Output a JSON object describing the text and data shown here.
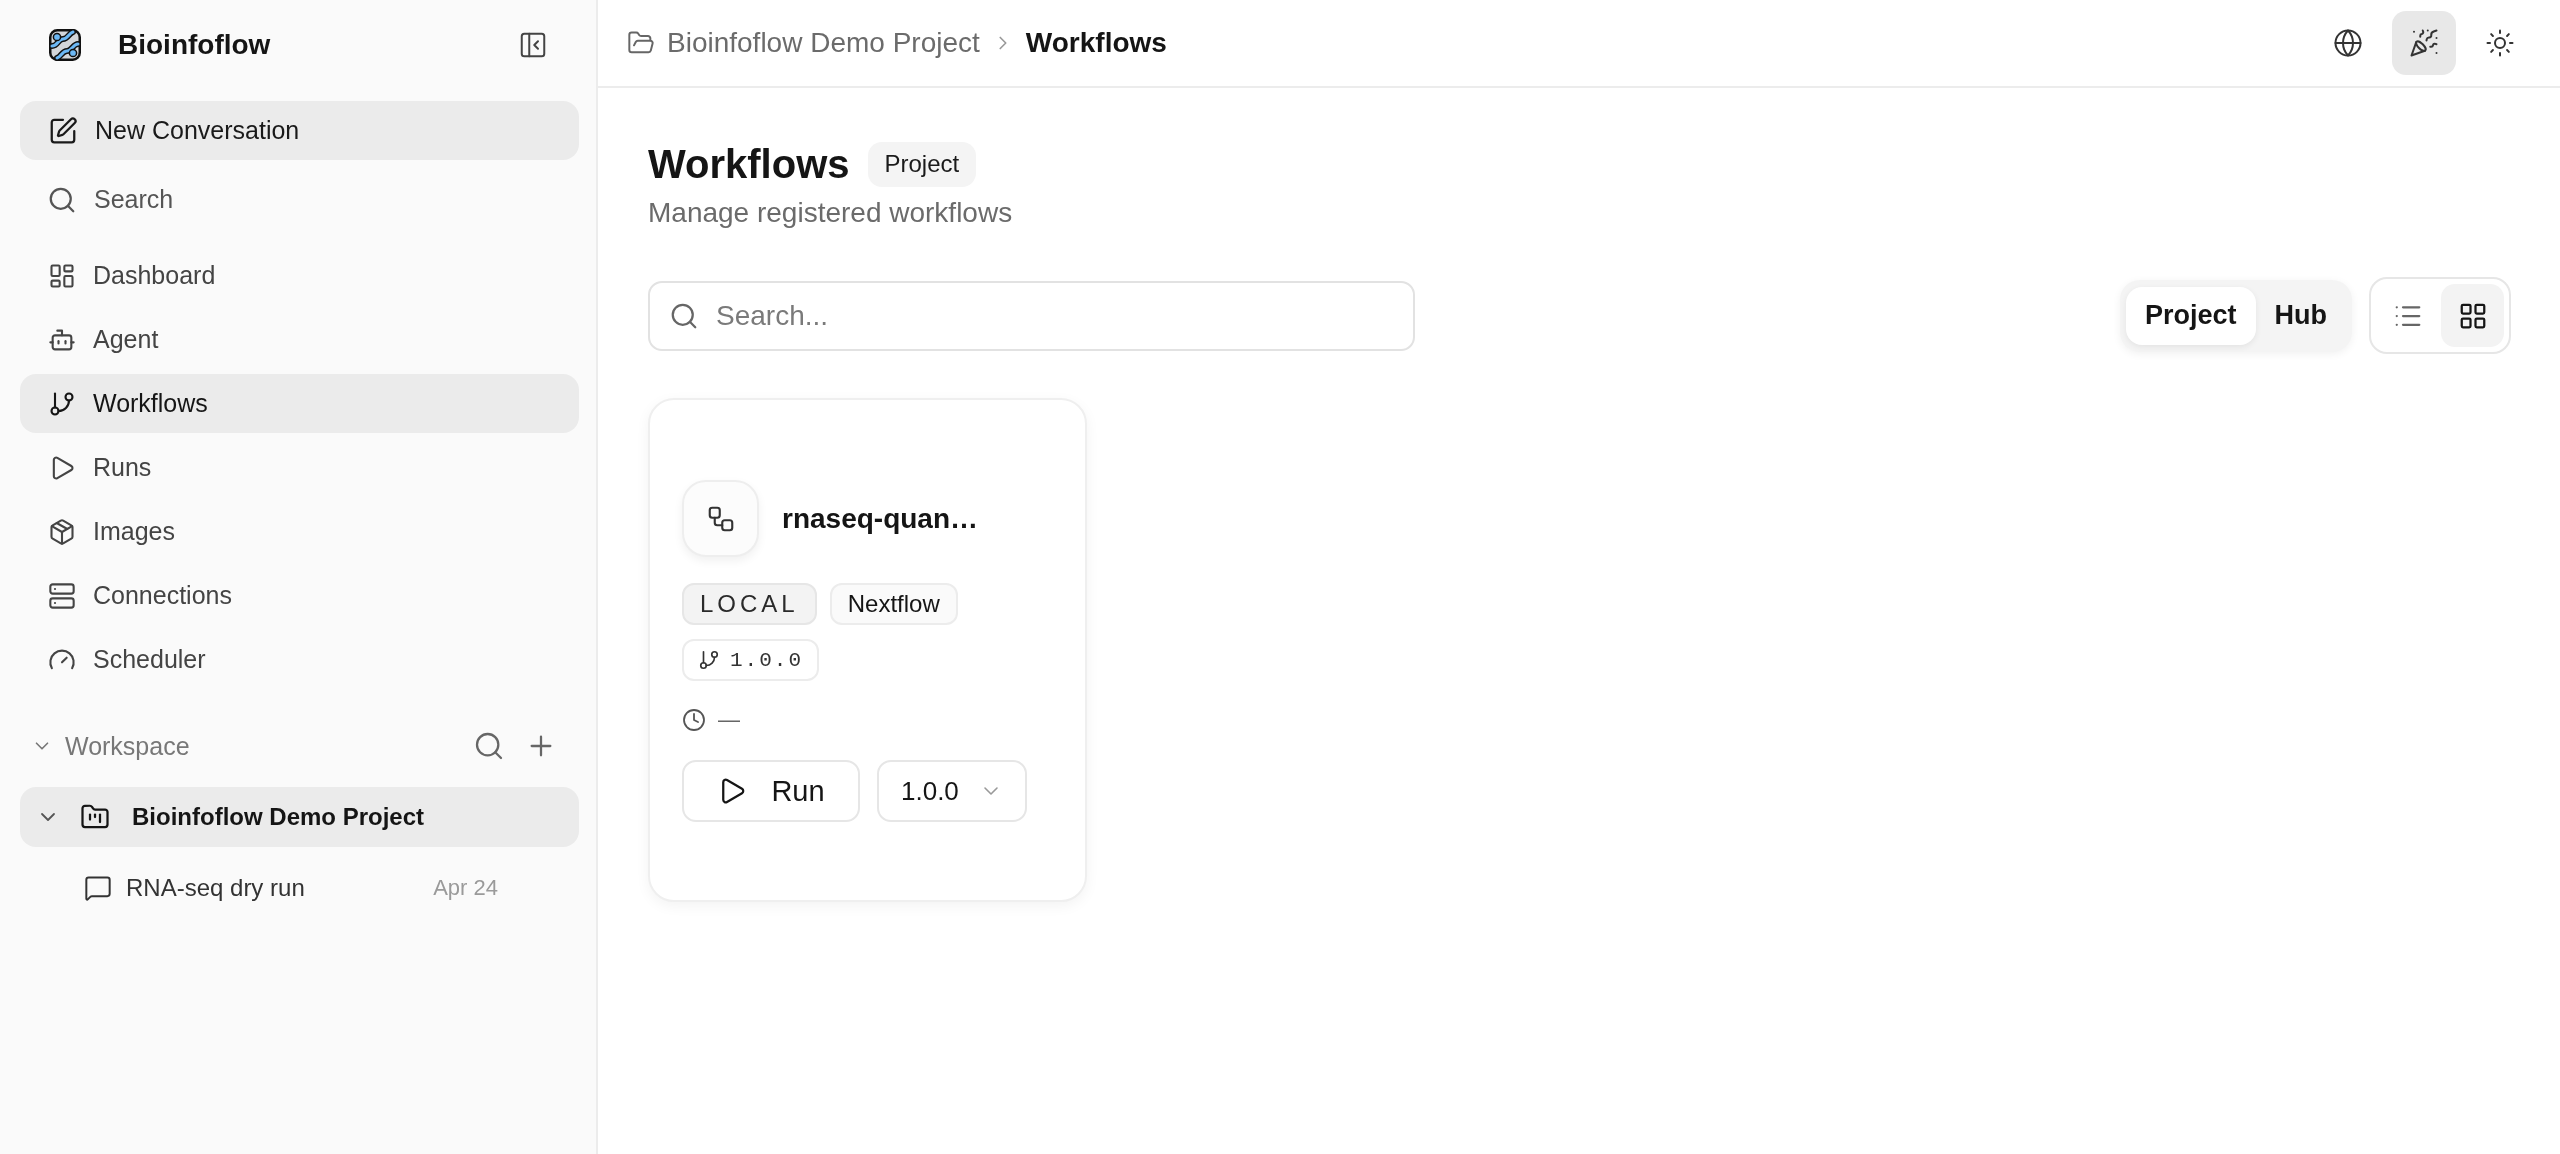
{
  "sidebar": {
    "brand": "Bioinfoflow",
    "new_conversation": "New Conversation",
    "search": "Search",
    "nav_items": [
      {
        "label": "Dashboard",
        "selected": false
      },
      {
        "label": "Agent",
        "selected": false
      },
      {
        "label": "Workflows",
        "selected": true
      },
      {
        "label": "Runs",
        "selected": false
      },
      {
        "label": "Images",
        "selected": false
      },
      {
        "label": "Connections",
        "selected": false
      },
      {
        "label": "Scheduler",
        "selected": false
      }
    ],
    "workspace": {
      "title": "Workspace",
      "expanded": true,
      "projects": [
        {
          "name": "Bioinfoflow Demo Project",
          "expanded": true,
          "selected": true,
          "children": [
            {
              "title": "RNA-seq dry run",
              "date": "Apr 24"
            }
          ]
        }
      ]
    }
  },
  "breadcrumb": [
    {
      "label": "Bioinfoflow Demo Project",
      "current": false
    },
    {
      "label": "Workflows",
      "current": true
    }
  ],
  "top_actions": [
    {
      "selected": false
    },
    {
      "selected": true
    },
    {
      "selected": false
    }
  ],
  "page": {
    "title": "Workflows",
    "badge": "Project",
    "subtitle": "Manage registered workflows"
  },
  "search": {
    "placeholder": "Search..."
  },
  "scope_tabs": [
    {
      "label": "Project",
      "selected": true
    },
    {
      "label": "Hub",
      "selected": false
    }
  ],
  "view_modes": [
    {
      "selected": false
    },
    {
      "selected": true
    }
  ],
  "workflows": [
    {
      "name": "rnaseq-quan…",
      "tags": [
        {
          "label": "LOCAL",
          "kind": "source"
        },
        {
          "label": "Nextflow",
          "kind": "engine"
        }
      ],
      "version": "1.0.0",
      "last_run": "—",
      "run_label": "Run",
      "selected_version": "1.0.0"
    }
  ]
}
